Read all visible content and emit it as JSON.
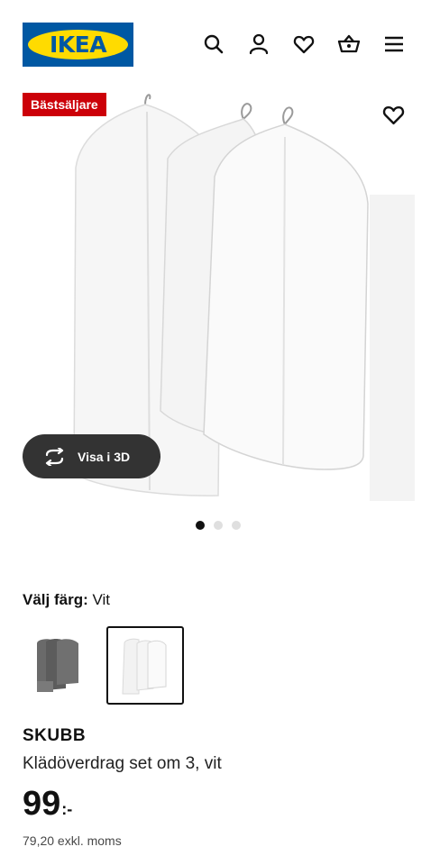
{
  "header": {
    "logo_text": "IKEA",
    "icons": [
      "search-icon",
      "profile-icon",
      "heart-icon",
      "basket-icon",
      "menu-icon"
    ]
  },
  "gallery": {
    "badge": "Bästsäljare",
    "view3d_label": "Visa i 3D",
    "image_count": 3,
    "active_image": 1
  },
  "product": {
    "color_key": "Välj färg:",
    "color_value": "Vit",
    "name": "SKUBB",
    "description": "Klädöverdrag set om 3, vit",
    "price_main": "99",
    "price_suffix": ":-",
    "price_excl": "79,20 exkl. moms"
  },
  "colors": {
    "accent": "#0058a3",
    "logo_yellow": "#ffdb00",
    "badge_bg": "#cc0008",
    "button_dark": "#333333"
  }
}
